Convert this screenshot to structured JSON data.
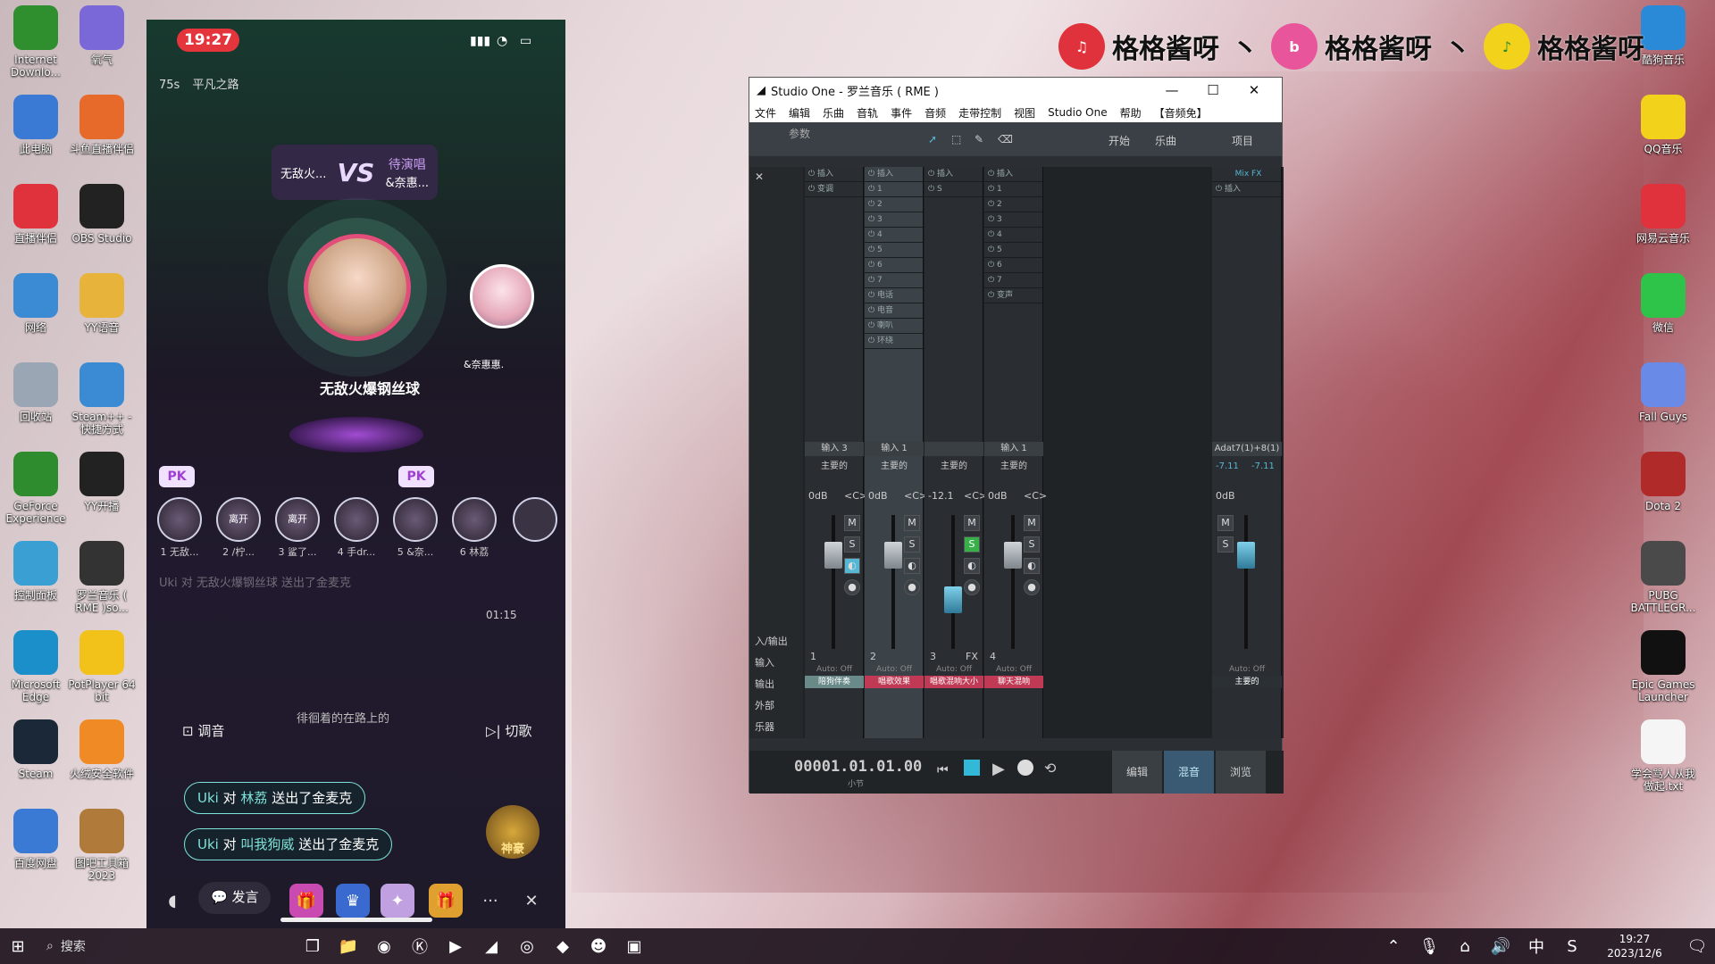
{
  "desktop": {
    "left_icons": [
      {
        "label": "Internet Downlo...",
        "icon": "idm-icon",
        "color": "#2f8f2f"
      },
      {
        "label": "氧气",
        "icon": "oxygen-icon",
        "color": "#7a68d8"
      },
      {
        "label": "此电脑",
        "icon": "computer-icon",
        "color": "#3a7ad4"
      },
      {
        "label": "斗鱼直播伴侣",
        "icon": "douyu-icon",
        "color": "#e86a2a"
      },
      {
        "label": "直播伴侣",
        "icon": "live-companion-icon",
        "color": "#e0323c"
      },
      {
        "label": "OBS Studio",
        "icon": "obs-icon",
        "color": "#222"
      },
      {
        "label": "网络",
        "icon": "network-icon",
        "color": "#3a8ad4"
      },
      {
        "label": "YY语音",
        "icon": "yy-icon",
        "color": "#e8b33a"
      },
      {
        "label": "回收站",
        "icon": "recycle-bin-icon",
        "color": "#9aa6b4"
      },
      {
        "label": "Steam++ - 快捷方式",
        "icon": "steampp-icon",
        "color": "#3a8ad4"
      },
      {
        "label": "GeForce Experience",
        "icon": "geforce-icon",
        "color": "#2e8b2e"
      },
      {
        "label": "YY开播",
        "icon": "yy-live-icon",
        "color": "#222"
      },
      {
        "label": "控制面板",
        "icon": "control-panel-icon",
        "color": "#3aa0d4"
      },
      {
        "label": "罗兰音乐 ( RME )so...",
        "icon": "studio-one-icon",
        "color": "#333"
      },
      {
        "label": "Microsoft Edge",
        "icon": "edge-icon",
        "color": "#1a8fc9"
      },
      {
        "label": "PotPlayer 64 bit",
        "icon": "potplayer-icon",
        "color": "#f2c21a"
      },
      {
        "label": "Steam",
        "icon": "steam-icon",
        "color": "#1b2838"
      },
      {
        "label": "火绒安全软件",
        "icon": "huorong-icon",
        "color": "#f08a24"
      },
      {
        "label": "百度网盘",
        "icon": "baidu-netdisk-icon",
        "color": "#3a7ad4"
      },
      {
        "label": "图吧工具箱2023",
        "icon": "toolbox-icon",
        "color": "#b07a3a"
      }
    ],
    "right_icons": [
      {
        "label": "酷狗音乐",
        "icon": "kugou-icon",
        "color": "#2a8ad8"
      },
      {
        "label": "QQ音乐",
        "icon": "qqmusic-icon",
        "color": "#f2d21a"
      },
      {
        "label": "网易云音乐",
        "icon": "netease-music-icon",
        "color": "#e0323c"
      },
      {
        "label": "微信",
        "icon": "wechat-icon",
        "color": "#2ec44a"
      },
      {
        "label": "Fall Guys",
        "icon": "fall-guys-icon",
        "color": "#6a8ae8"
      },
      {
        "label": "Dota 2",
        "icon": "dota2-icon",
        "color": "#b02a2a"
      },
      {
        "label": "PUBG BATTLEGR...",
        "icon": "pubg-icon",
        "color": "#4a4a4a"
      },
      {
        "label": "Epic Games Launcher",
        "icon": "epic-icon",
        "color": "#111"
      },
      {
        "label": "学会骂人从我做起.txt",
        "icon": "text-file-icon",
        "color": "#f5f5f5"
      }
    ],
    "banner": {
      "name": "格格酱呀",
      "separator": "丶"
    }
  },
  "phone": {
    "time": "19:27",
    "room_tag": "75s",
    "song": "平凡之路",
    "vs": {
      "left": "无敌火...",
      "vs": "VS",
      "right_status": "待演唱",
      "right": "&奈惠..."
    },
    "host_name": "无敌火爆钢丝球",
    "opponent_name": "&奈惠惠.",
    "pk_badge": "PK",
    "seats": [
      {
        "label": "1 无敌..."
      },
      {
        "label": "2 /柠..."
      },
      {
        "label": "3 鲨了..."
      },
      {
        "label": "4 手dr..."
      },
      {
        "label": "5 &奈..."
      },
      {
        "label": "6 林荔"
      }
    ],
    "seat_leave": "离开",
    "faded_chat": [
      "Uki 对 无敌火爆钢丝球 送出了金麦克",
      "徘徊着的在路上的"
    ],
    "chat_timer": "01:15",
    "btn_tune": "调音",
    "btn_switch": "切歌",
    "chat": [
      {
        "user": "Uki",
        "mid": "对",
        "target": "林荔",
        "action": "送出了金麦克"
      },
      {
        "user": "Uki",
        "mid": "对",
        "target": "叫我狗威",
        "action": "送出了金麦克"
      }
    ],
    "send_label": "发言",
    "gift_chest_label": "神豪"
  },
  "studio_one": {
    "title": "Studio One - 罗兰音乐 ( RME )",
    "menu": [
      "文件",
      "编辑",
      "乐曲",
      "音轨",
      "事件",
      "音频",
      "走带控制",
      "视图",
      "Studio One",
      "帮助",
      "【音频免】"
    ],
    "toolbar": {
      "param": "参数",
      "start": "开始",
      "song": "乐曲",
      "project": "项目"
    },
    "sidebar": [
      "入/输出",
      "输入",
      "输出",
      "外部",
      "乐器"
    ],
    "insert_label": "插入",
    "mixfx_label": "Mix FX",
    "channels": [
      {
        "slots": [
          "变调"
        ],
        "name": "输入 3",
        "route": "主要的",
        "db": "0dB",
        "pan": "<C>",
        "num": "1",
        "auto": "Auto: Off",
        "label": "陪狗伴奏",
        "label_color": "#6a8a8a"
      },
      {
        "slots": [
          "1",
          "2",
          "3",
          "4",
          "5",
          "6",
          "7",
          "电话",
          "电音",
          "喇叭",
          "环绕"
        ],
        "name": "输入 1",
        "route": "主要的",
        "db": "0dB",
        "pan": "<C>",
        "num": "2",
        "auto": "Auto: Off",
        "label": "唱歌效果",
        "label_color": "#c03a55"
      },
      {
        "slots": [
          "S"
        ],
        "name": "",
        "route": "主要的",
        "db": "-12.1",
        "pan": "<C>",
        "num": "3",
        "auto": "Auto: Off",
        "label": "唱歌混响大小",
        "label_color": "#c03a55"
      },
      {
        "slots": [
          "1",
          "2",
          "3",
          "4",
          "5",
          "6",
          "7",
          "变声"
        ],
        "name": "输入 1",
        "route": "主要的",
        "db": "0dB",
        "pan": "<C>",
        "num": "4",
        "auto": "Auto: Off",
        "label": "聊天混响",
        "label_color": "#c03a55"
      }
    ],
    "master": {
      "name": "Adat7(1)+8(1)",
      "levels": [
        "-7.11",
        "-7.11"
      ],
      "db": "0dB",
      "auto": "Auto: Off",
      "label": "主要的"
    },
    "btn_m": "M",
    "btn_s": "S",
    "fx_label": "FX",
    "transport": {
      "time": "00001.01.01.00",
      "unit": "小节",
      "edit": "编辑",
      "mix": "混音",
      "browse": "浏览"
    }
  },
  "taskbar": {
    "search": "搜索",
    "time": "19:27",
    "date": "2023/12/6",
    "ime": "中"
  }
}
